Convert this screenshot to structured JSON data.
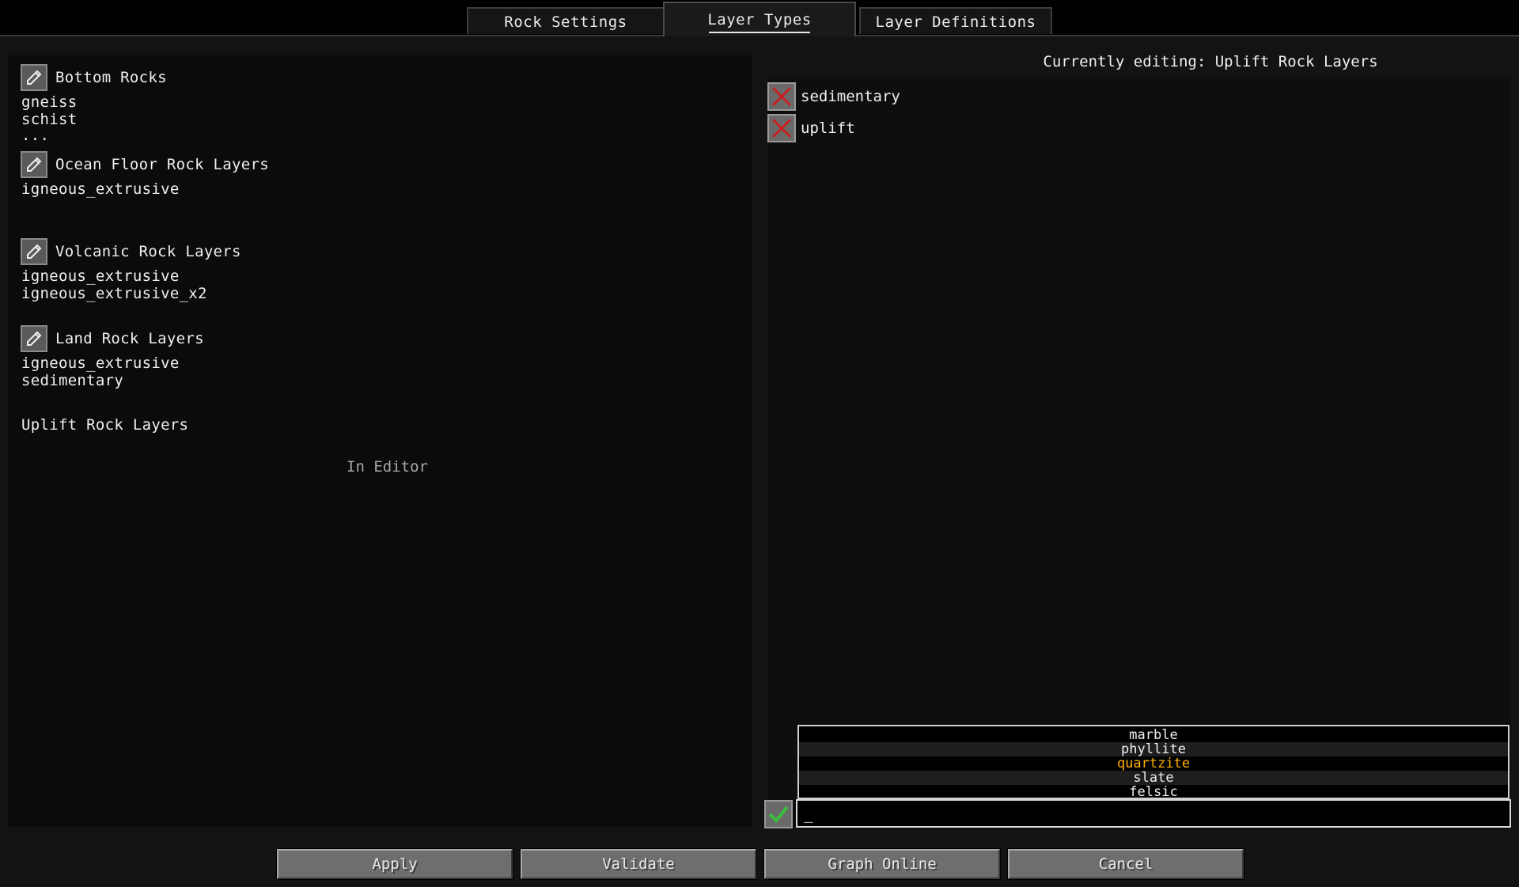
{
  "tabs": [
    {
      "label": "Rock Settings"
    },
    {
      "label": "Layer Types"
    },
    {
      "label": "Layer Definitions"
    }
  ],
  "left_panel": {
    "groups": [
      {
        "title": "Bottom Rocks",
        "items": [
          "gneiss",
          "schist",
          "..."
        ]
      },
      {
        "title": "Ocean Floor Rock Layers",
        "items": [
          "igneous_extrusive"
        ]
      },
      {
        "title": "Volcanic Rock Layers",
        "items": [
          "igneous_extrusive",
          "igneous_extrusive_x2"
        ]
      },
      {
        "title": "Land Rock Layers",
        "items": [
          "igneous_extrusive",
          "sedimentary"
        ]
      }
    ],
    "editing_group_title": "Uplift Rock Layers",
    "in_editor_label": "In Editor"
  },
  "right_panel": {
    "editing_title": "Currently editing: Uplift Rock Layers",
    "layers": [
      "sedimentary",
      "uplift"
    ],
    "suggestions": [
      "marble",
      "phyllite",
      "quartzite",
      "slate",
      "felsic"
    ],
    "highlighted_suggestion": "quartzite",
    "input_value": "_"
  },
  "buttons": {
    "apply": "Apply",
    "validate": "Validate",
    "graph_online": "Graph Online",
    "cancel": "Cancel"
  },
  "colors": {
    "highlight": "#ffb000",
    "remove_x": "#c82020",
    "confirm_check": "#3cbf3c"
  },
  "icons": {
    "edit": "pencil-icon",
    "remove": "x-icon",
    "confirm": "checkmark-icon"
  }
}
